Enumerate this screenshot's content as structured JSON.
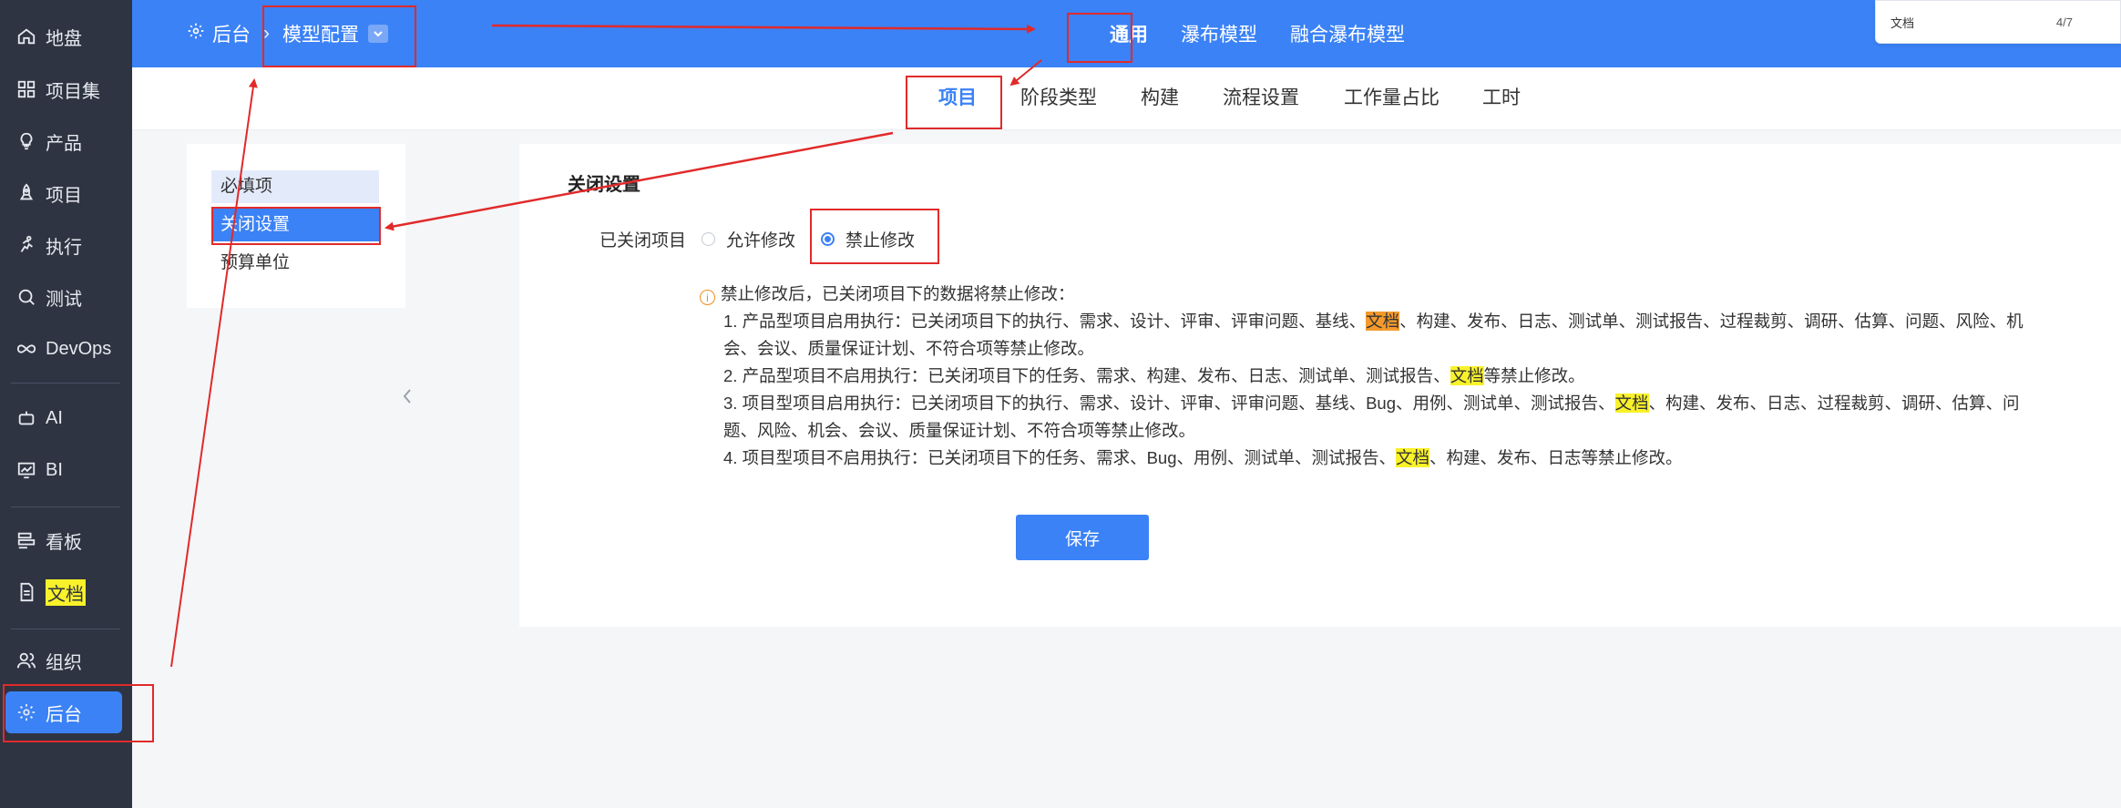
{
  "sidebar": {
    "items": [
      {
        "label": "地盘",
        "icon": "home-icon"
      },
      {
        "label": "项目集",
        "icon": "grid-icon"
      },
      {
        "label": "产品",
        "icon": "bulb-icon"
      },
      {
        "label": "项目",
        "icon": "rocket-icon"
      },
      {
        "label": "执行",
        "icon": "run-icon"
      },
      {
        "label": "测试",
        "icon": "search-icon"
      },
      {
        "label": "DevOps",
        "icon": "infinity-icon"
      },
      {
        "label": "AI",
        "icon": "robot-icon"
      },
      {
        "label": "BI",
        "icon": "chart-icon"
      },
      {
        "label": "看板",
        "icon": "board-icon"
      },
      {
        "label": "文档",
        "icon": "doc-icon"
      },
      {
        "label": "组织",
        "icon": "users-icon"
      },
      {
        "label": "后台",
        "icon": "gear-icon"
      }
    ],
    "active": "后台"
  },
  "header": {
    "breadcrumb_root": "后台",
    "breadcrumb_sep": "›",
    "breadcrumb_current": "模型配置",
    "tabs": [
      "通用",
      "瀑布模型",
      "融合瀑布模型"
    ],
    "active_tab": "通用"
  },
  "find": {
    "text": "文档",
    "count": "4/7"
  },
  "subtabs": [
    "项目",
    "阶段类型",
    "构建",
    "流程设置",
    "工作量占比",
    "工时"
  ],
  "left_menu": [
    "必填项",
    "关闭设置",
    "预算单位"
  ],
  "main": {
    "title": "关闭设置",
    "field_label": "已关闭项目",
    "option_allow": "允许修改",
    "option_forbid": "禁止修改",
    "selected": "禁止修改",
    "notice_head": "禁止修改后，已关闭项目下的数据将禁止修改：",
    "n1a": "1. 产品型项目启用执行：已关闭项目下的执行、需求、设计、评审、评审问题、基线、",
    "n1mark": "文档",
    "n1b": "、构建、发布、日志、测试单、测试报告、过程裁剪、调研、估算、问题、风险、机",
    "n1c": "会、会议、质量保证计划、不符合项等禁止修改。",
    "n2a": "2. 产品型项目不启用执行：已关闭项目下的任务、需求、构建、发布、日志、测试单、测试报告、",
    "n2mark": "文档",
    "n2b": "等禁止修改。",
    "n3a": "3. 项目型项目启用执行：已关闭项目下的执行、需求、设计、评审、评审问题、基线、Bug、用例、测试单、测试报告、",
    "n3mark": "文档",
    "n3b": "、构建、发布、日志、过程裁剪、调研、估算、问",
    "n3c": "题、风险、机会、会议、质量保证计划、不符合项等禁止修改。",
    "n4a": "4. 项目型项目不启用执行：已关闭项目下的任务、需求、Bug、用例、测试单、测试报告、",
    "n4mark": "文档",
    "n4b": "、构建、发布、日志等禁止修改。",
    "save_label": "保存"
  },
  "colors": {
    "accent": "#3b82f6",
    "sidebar": "#2e3442",
    "annotation": "#e12a2a",
    "highlight": "#f9f12a",
    "highlight_current": "#f39a2d"
  }
}
